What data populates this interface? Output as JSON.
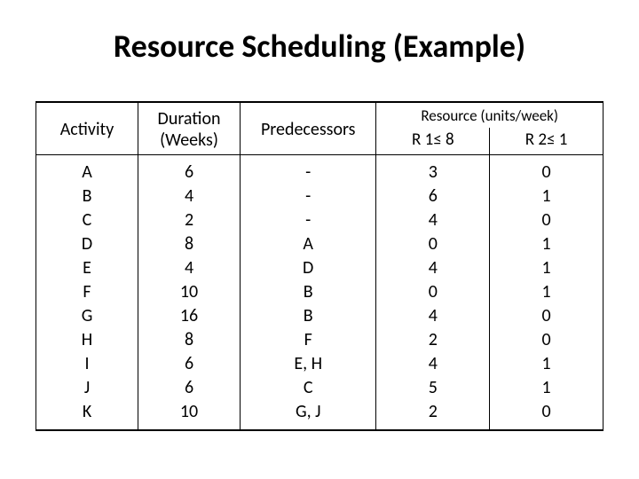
{
  "title": "Resource Scheduling (Example)",
  "headers": {
    "activity": "Activity",
    "duration": "Duration (Weeks)",
    "predecessors": "Predecessors",
    "resource": "Resource (units/week)",
    "r1": "R 1≤ 8",
    "r2": "R 2≤ 1"
  },
  "rows": [
    {
      "activity": "A",
      "duration": "6",
      "predecessors": "-",
      "r1": "3",
      "r2": "0"
    },
    {
      "activity": "B",
      "duration": "4",
      "predecessors": "-",
      "r1": "6",
      "r2": "1"
    },
    {
      "activity": "C",
      "duration": "2",
      "predecessors": "-",
      "r1": "4",
      "r2": "0"
    },
    {
      "activity": "D",
      "duration": "8",
      "predecessors": "A",
      "r1": "0",
      "r2": "1"
    },
    {
      "activity": "E",
      "duration": "4",
      "predecessors": "D",
      "r1": "4",
      "r2": "1"
    },
    {
      "activity": "F",
      "duration": "10",
      "predecessors": "B",
      "r1": "0",
      "r2": "1"
    },
    {
      "activity": "G",
      "duration": "16",
      "predecessors": "B",
      "r1": "4",
      "r2": "0"
    },
    {
      "activity": "H",
      "duration": "8",
      "predecessors": "F",
      "r1": "2",
      "r2": "0"
    },
    {
      "activity": "I",
      "duration": "6",
      "predecessors": "E, H",
      "r1": "4",
      "r2": "1"
    },
    {
      "activity": "J",
      "duration": "6",
      "predecessors": "C",
      "r1": "5",
      "r2": "1"
    },
    {
      "activity": "K",
      "duration": "10",
      "predecessors": "G, J",
      "r1": "2",
      "r2": "0"
    }
  ],
  "chart_data": {
    "type": "table",
    "title": "Resource Scheduling (Example)",
    "columns": [
      "Activity",
      "Duration (Weeks)",
      "Predecessors",
      "R1 (≤8)",
      "R2 (≤1)"
    ],
    "data": [
      [
        "A",
        6,
        "-",
        3,
        0
      ],
      [
        "B",
        4,
        "-",
        6,
        1
      ],
      [
        "C",
        2,
        "-",
        4,
        0
      ],
      [
        "D",
        8,
        "A",
        0,
        1
      ],
      [
        "E",
        4,
        "D",
        4,
        1
      ],
      [
        "F",
        10,
        "B",
        0,
        1
      ],
      [
        "G",
        16,
        "B",
        4,
        0
      ],
      [
        "H",
        8,
        "F",
        2,
        0
      ],
      [
        "I",
        6,
        "E, H",
        4,
        1
      ],
      [
        "J",
        6,
        "C",
        5,
        1
      ],
      [
        "K",
        10,
        "G, J",
        2,
        0
      ]
    ]
  }
}
